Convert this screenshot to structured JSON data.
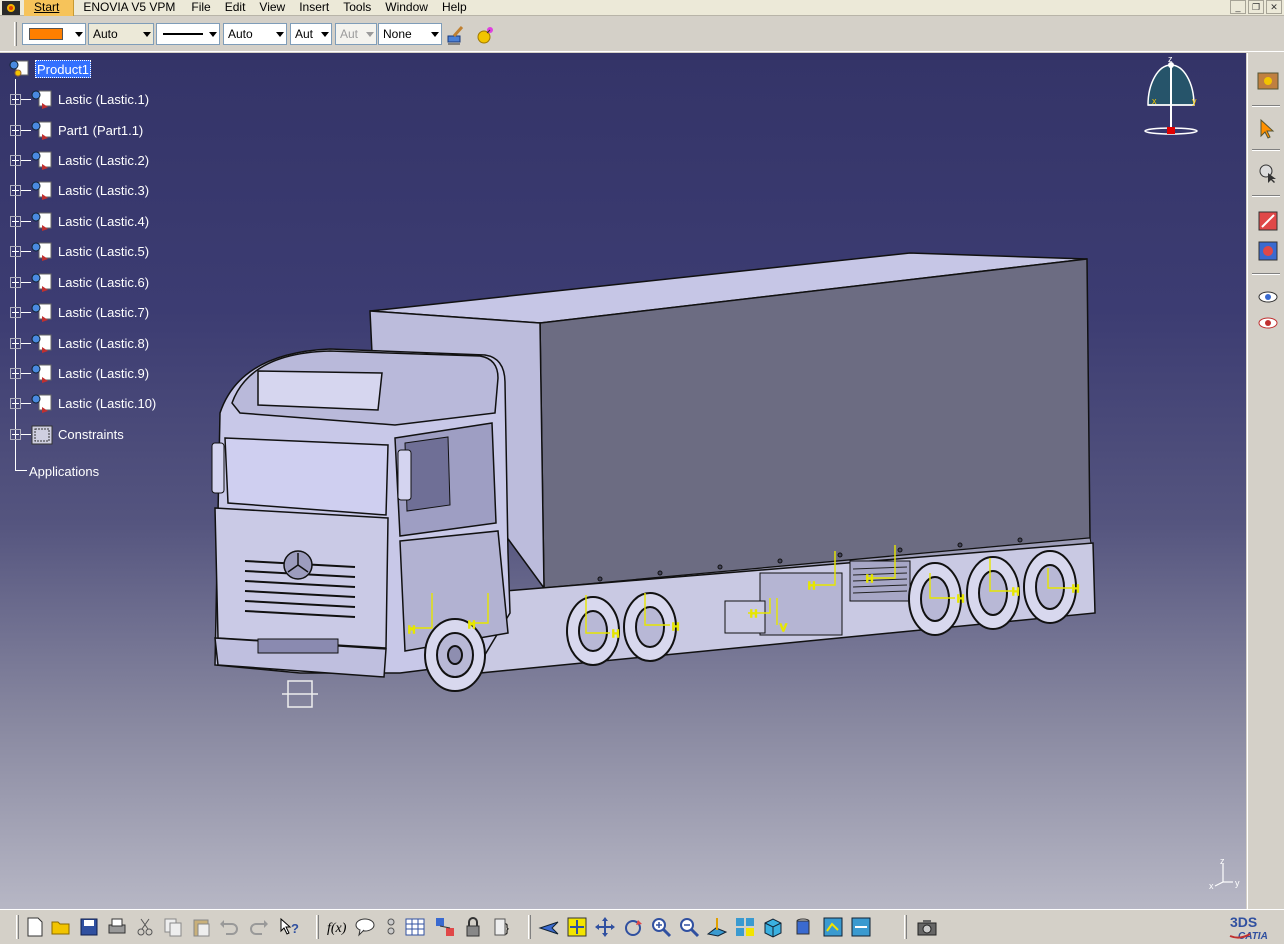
{
  "menubar": {
    "items": [
      {
        "label": "Start"
      },
      {
        "label": "ENOVIA V5 VPM"
      },
      {
        "label": "File"
      },
      {
        "label": "Edit"
      },
      {
        "label": "View"
      },
      {
        "label": "Insert"
      },
      {
        "label": "Tools"
      },
      {
        "label": "Window"
      },
      {
        "label": "Help"
      }
    ]
  },
  "properties_toolbar": {
    "fill_color": "#ff7f00",
    "transparency": "Auto",
    "line_thickness": "Auto",
    "point_symbol": "Aut",
    "point_symbol_disabled": "Aut",
    "layer": "None"
  },
  "tree": {
    "root": "Product1",
    "nodes": [
      {
        "label": "Lastic (Lastic.1)"
      },
      {
        "label": "Part1 (Part1.1)"
      },
      {
        "label": "Lastic (Lastic.2)"
      },
      {
        "label": "Lastic (Lastic.3)"
      },
      {
        "label": "Lastic (Lastic.4)"
      },
      {
        "label": "Lastic (Lastic.5)"
      },
      {
        "label": "Lastic (Lastic.6)"
      },
      {
        "label": "Lastic (Lastic.7)"
      },
      {
        "label": "Lastic (Lastic.8)"
      },
      {
        "label": "Lastic (Lastic.9)"
      },
      {
        "label": "Lastic (Lastic.10)"
      },
      {
        "label": "Constraints"
      }
    ],
    "applications": "Applications"
  },
  "compass": {
    "x": "x",
    "y": "y",
    "z": "z"
  },
  "axis_triad": {
    "x": "x",
    "y": "y",
    "z": "z"
  },
  "constraint_labels": {
    "h": "H",
    "v": "V"
  },
  "logo": {
    "brand": "CATIA",
    "mark": "3DS"
  },
  "colors": {
    "accent": "#ff7f00",
    "selection": "#3370ff",
    "background_top": "#343468",
    "background_bottom": "#b7b7c5",
    "constraint": "#e6e600"
  }
}
